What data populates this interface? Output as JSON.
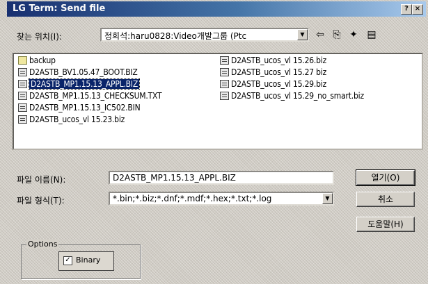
{
  "window": {
    "title": "LG Term: Send file",
    "help_glyph": "?",
    "close_glyph": "×"
  },
  "look_in": {
    "label": "찾는 위치(I):",
    "value": "정희석:haru0828:Video개발그룹 (Ptc",
    "icons": [
      "back-icon",
      "up-folder-icon",
      "new-folder-icon",
      "view-menu-icon"
    ],
    "glyphs": {
      "back": "⇦",
      "up": "⎘",
      "new_folder": "✦",
      "view": "▤"
    }
  },
  "files": [
    {
      "name": "backup",
      "type": "folder",
      "selected": false
    },
    {
      "name": "D2ASTB_BV1.05.47_BOOT.BIZ",
      "type": "file",
      "selected": false
    },
    {
      "name": "D2ASTB_MP1.15.13_APPL.BIZ",
      "type": "file",
      "selected": true
    },
    {
      "name": "D2ASTB_MP1.15.13_CHECKSUM.TXT",
      "type": "file",
      "selected": false
    },
    {
      "name": "D2ASTB_MP1.15.13_IC502.BIN",
      "type": "file",
      "selected": false
    },
    {
      "name": "D2ASTB_ucos_vl 15.23.biz",
      "type": "file",
      "selected": false
    },
    {
      "name": "D2ASTB_ucos_vl 15.26.biz",
      "type": "file",
      "selected": false
    },
    {
      "name": "D2ASTB_ucos_vl 15.27 biz",
      "type": "file",
      "selected": false
    },
    {
      "name": "D2ASTB_ucos_vl 15.29.biz",
      "type": "file",
      "selected": false
    },
    {
      "name": "D2ASTB_ucos_vl 15.29_no_smart.biz",
      "type": "file",
      "selected": false
    }
  ],
  "filename": {
    "label": "파일 이름(N):",
    "value": "D2ASTB_MP1.15.13_APPL.BIZ"
  },
  "filetype": {
    "label": "파일 형식(T):",
    "value": "*.bin;*.biz;*.dnf;*.mdf;*.hex;*.txt;*.log"
  },
  "buttons": {
    "open": "열기(O)",
    "cancel": "취소",
    "help": "도움말(H)"
  },
  "options": {
    "label": "Options",
    "binary_label": "Binary",
    "binary_checked": true,
    "check_glyph": "✓"
  }
}
